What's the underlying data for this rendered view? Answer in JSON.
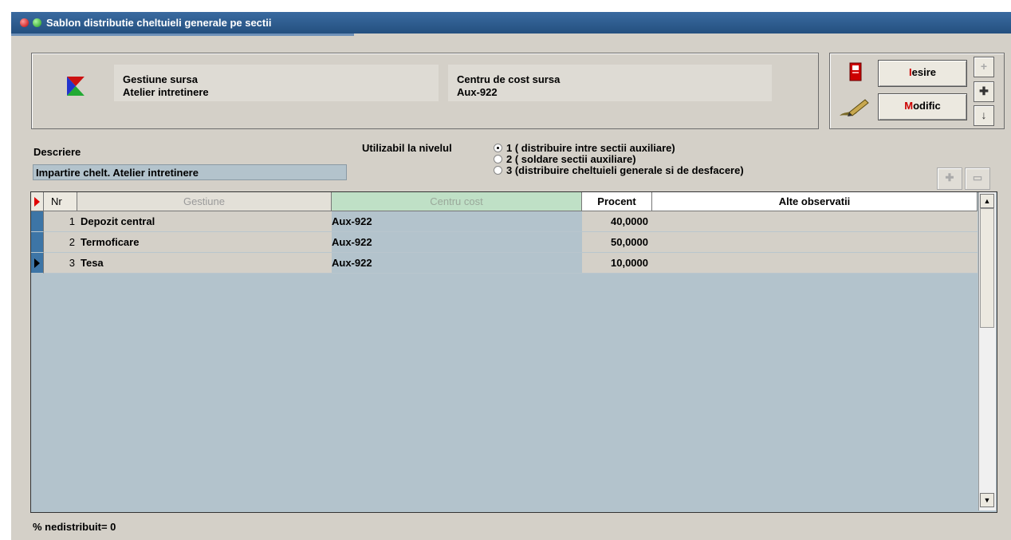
{
  "window": {
    "title": "Sablon distributie cheltuieli generale pe sectii"
  },
  "info": {
    "gestiune_label": "Gestiune sursa",
    "gestiune_value": "Atelier intretinere",
    "centru_label": "Centru de cost sursa",
    "centru_value": "Aux-922"
  },
  "buttons": {
    "iesire_hot": "I",
    "iesire_rest": "esire",
    "modific_hot": "M",
    "modific_rest": "odific",
    "nav_up": "+",
    "nav_plus": "✚",
    "nav_down": "↓"
  },
  "description": {
    "label": "Descriere",
    "value": "Impartire chelt. Atelier intretinere"
  },
  "level": {
    "label": "Utilizabil la nivelul",
    "options": [
      {
        "text": "1 ( distribuire intre sectii auxiliare)",
        "selected": true
      },
      {
        "text": "2 ( soldare sectii auxiliare)",
        "selected": false
      },
      {
        "text": "3 (distribuire cheltuieli generale si de desfacere)",
        "selected": false
      }
    ]
  },
  "grid_tools": {
    "add": "✚",
    "remove": "▭"
  },
  "table": {
    "columns": {
      "nr": "Nr",
      "gestiune": "Gestiune",
      "centru_cost": "Centru cost",
      "procent": "Procent",
      "alte_observatii": "Alte observatii"
    },
    "rows": [
      {
        "nr": "1",
        "gestiune": "Depozit central",
        "centru_cost": "Aux-922",
        "procent": "40,0000",
        "alte_observatii": ""
      },
      {
        "nr": "2",
        "gestiune": "Termoficare",
        "centru_cost": "Aux-922",
        "procent": "50,0000",
        "alte_observatii": ""
      },
      {
        "nr": "3",
        "gestiune": "Tesa",
        "centru_cost": "Aux-922",
        "procent": "10,0000",
        "alte_observatii": ""
      }
    ],
    "current_row_index": 2
  },
  "footer": {
    "text": "% nedistribuit=  0"
  },
  "colors": {
    "titlebar": "#24507f",
    "grid_bg": "#b3c3cc",
    "hotkey": "#cc0000",
    "row_indicator": "#3d75a6"
  }
}
